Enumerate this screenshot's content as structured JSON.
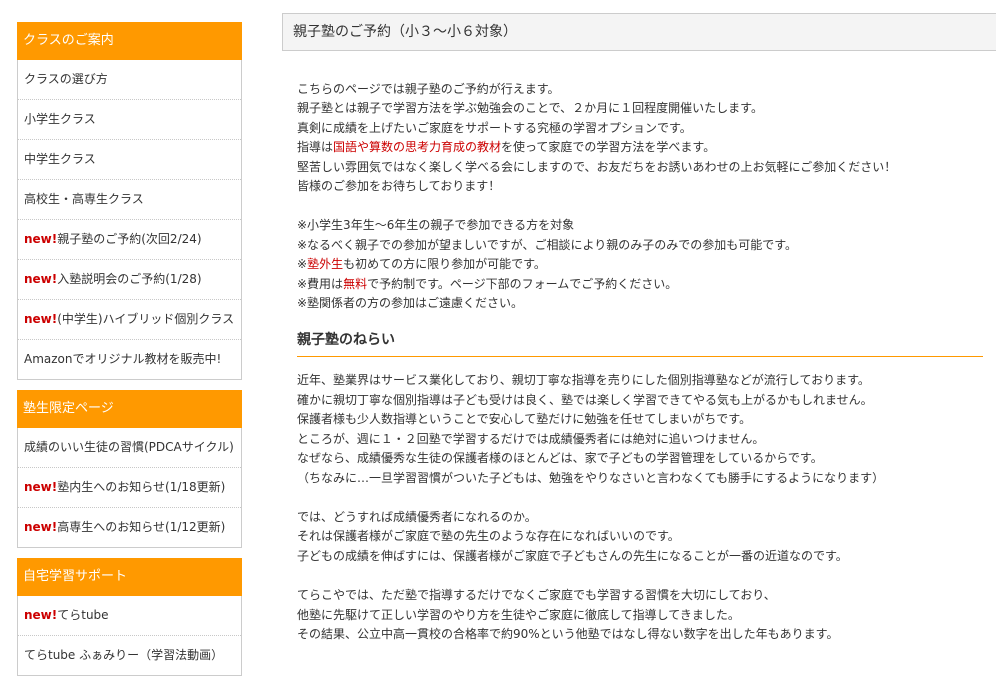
{
  "sidebar": {
    "sections": [
      {
        "title": "クラスのご案内",
        "items": [
          {
            "prefix": "",
            "label": "クラスの選び方"
          },
          {
            "prefix": "",
            "label": "小学生クラス"
          },
          {
            "prefix": "",
            "label": "中学生クラス"
          },
          {
            "prefix": "",
            "label": "高校生・高専生クラス"
          },
          {
            "prefix": "new!",
            "label": "親子塾のご予約(次回2/24)"
          },
          {
            "prefix": "new!",
            "label": "入塾説明会のご予約(1/28)"
          },
          {
            "prefix": "new!",
            "label": "(中学生)ハイブリッド個別クラス"
          },
          {
            "prefix": "",
            "label": "Amazonでオリジナル教材を販売中!"
          }
        ]
      },
      {
        "title": "塾生限定ページ",
        "items": [
          {
            "prefix": "",
            "label": "成績のいい生徒の習慣(PDCAサイクル)"
          },
          {
            "prefix": "new!",
            "label": "塾内生へのお知らせ(1/18更新)"
          },
          {
            "prefix": "new!",
            "label": "高専生へのお知らせ(1/12更新)"
          }
        ]
      },
      {
        "title": "自宅学習サポート",
        "items": [
          {
            "prefix": "new!",
            "label": "てらtube"
          },
          {
            "prefix": "",
            "label": "てらtube ふぁみりー（学習法動画）"
          }
        ]
      }
    ]
  },
  "main": {
    "title": "親子塾のご予約（小３～小６対象）",
    "intro": [
      "こちらのページでは親子塾のご予約が行えます。",
      "親子塾とは親子で学習方法を学ぶ勉強会のことで、２か月に１回程度開催いたします。",
      "真剣に成績を上げたいご家庭をサポートする究極の学習オプションです。",
      {
        "pre": "指導は",
        "red": "国語や算数の思考力育成の教材",
        "post": "を使って家庭での学習方法を学べます。"
      },
      "堅苦しい雰囲気ではなく楽しく学べる会にしますので、お友だちをお誘いあわせの上お気軽にご参加ください！",
      "皆様のご参加をお待ちしております！"
    ],
    "notes": [
      "※小学生3年生～6年生の親子で参加できる方を対象",
      "※なるべく親子での参加が望ましいですが、ご相談により親のみ子のみでの参加も可能です。",
      {
        "pre": "※",
        "red": "塾外生",
        "post": "も初めての方に限り参加が可能です。"
      },
      {
        "pre": "※費用は",
        "red": "無料",
        "post": "で予約制です。ページ下部のフォームでご予約ください。"
      },
      "※塾関係者の方の参加はご遠慮ください。"
    ],
    "aim_title": "親子塾のねらい",
    "aim_p1": [
      "近年、塾業界はサービス業化しており、親切丁寧な指導を売りにした個別指導塾などが流行しております。",
      "確かに親切丁寧な個別指導は子ども受けは良く、塾では楽しく学習できてやる気も上がるかもしれません。",
      "保護者様も少人数指導ということで安心して塾だけに勉強を任せてしまいがちです。",
      "ところが、週に１・２回塾で学習するだけでは成績優秀者には絶対に追いつけません。",
      "なぜなら、成績優秀な生徒の保護者様のほとんどは、家で子どもの学習管理をしているからです。",
      "（ちなみに…一旦学習習慣がついた子どもは、勉強をやりなさいと言わなくても勝手にするようになります）"
    ],
    "aim_p2": [
      "では、どうすれば成績優秀者になれるのか。",
      "それは保護者様がご家庭で塾の先生のような存在になればいいのです。",
      "子どもの成績を伸ばすには、保護者様がご家庭で子どもさんの先生になることが一番の近道なのです。"
    ],
    "aim_p3": [
      "てらこやでは、ただ塾で指導するだけでなくご家庭でも学習する習慣を大切にしており、",
      "他塾に先駆けて正しい学習のやり方を生徒やご家庭に徹底して指導してきました。",
      "その結果、公立中高一貫校の合格率で約90%という他塾ではなし得ない数字を出した年もあります。"
    ]
  }
}
